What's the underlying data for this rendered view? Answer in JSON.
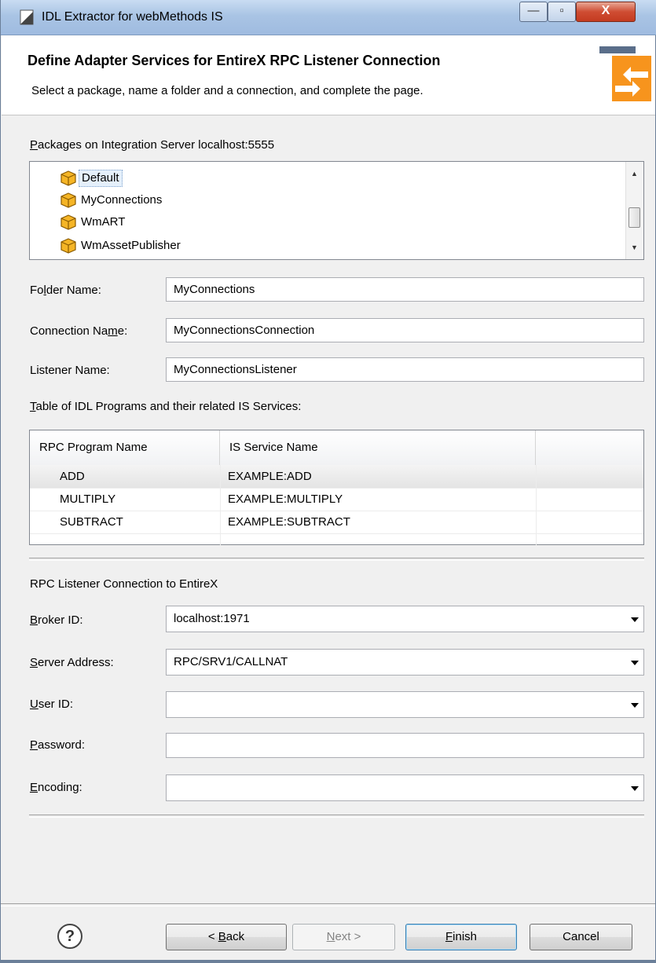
{
  "window": {
    "title": "IDL Extractor for webMethods IS",
    "buttons": {
      "minimize": "—",
      "maximize": "▫",
      "close": "X"
    }
  },
  "header": {
    "title": "Define Adapter Services for EntireX RPC Listener Connection",
    "subtitle": "Select a package, name a folder and a connection, and complete the page.",
    "banner_color": "#f7941d"
  },
  "packages": {
    "label_pre": "",
    "label_mnemonic": "P",
    "label_post": "ackages on Integration Server localhost:5555",
    "items": [
      "Default",
      "MyConnections",
      "WmART",
      "WmAssetPublisher"
    ],
    "selected": "Default"
  },
  "folder": {
    "label_pre": "Fo",
    "label_mnemonic": "l",
    "label_post": "der Name:",
    "value": "MyConnections"
  },
  "connection": {
    "label_pre": "Connection Na",
    "label_mnemonic": "m",
    "label_post": "e:",
    "value": "MyConnectionsConnection"
  },
  "listener": {
    "label": "Listener Name:",
    "value": "MyConnectionsListener"
  },
  "table": {
    "label_mnemonic": "T",
    "label_post": "able of IDL Programs and their related IS Services:",
    "columns": [
      "RPC Program Name",
      "IS Service Name"
    ],
    "rows": [
      {
        "program": "ADD",
        "service": "EXAMPLE:ADD"
      },
      {
        "program": "MULTIPLY",
        "service": "EXAMPLE:MULTIPLY"
      },
      {
        "program": "SUBTRACT",
        "service": "EXAMPLE:SUBTRACT"
      }
    ]
  },
  "rpc_section": {
    "title": "RPC Listener Connection to EntireX",
    "broker": {
      "label_mnemonic": "B",
      "label_post": "roker ID:",
      "value": "localhost:1971"
    },
    "server": {
      "label_mnemonic": "S",
      "label_post": "erver Address:",
      "value": "RPC/SRV1/CALLNAT"
    },
    "user": {
      "label_mnemonic": "U",
      "label_post": "ser ID:",
      "value": ""
    },
    "password": {
      "label_mnemonic": "P",
      "label_post": "assword:",
      "value": ""
    },
    "encoding": {
      "label_mnemonic": "E",
      "label_post": "ncoding:",
      "value": ""
    }
  },
  "footer": {
    "help": "?",
    "back_pre": "< ",
    "back_mnemonic": "B",
    "back_post": "ack",
    "next_mnemonic": "N",
    "next_post": "ext >",
    "finish_mnemonic": "F",
    "finish_post": "inish",
    "cancel": "Cancel"
  }
}
